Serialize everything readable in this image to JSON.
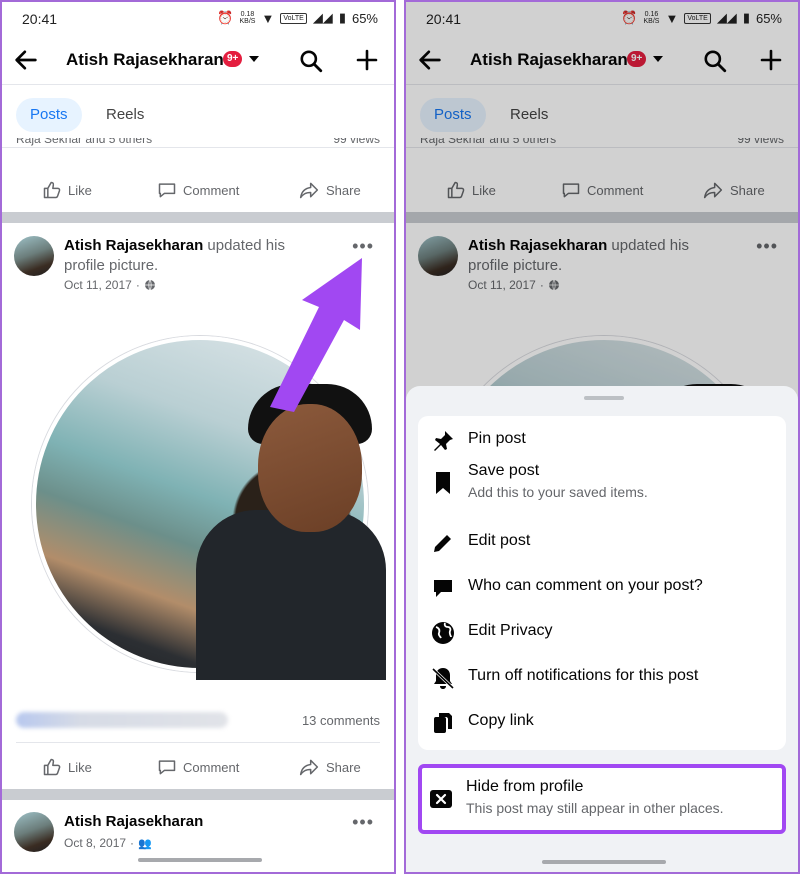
{
  "status_bar": {
    "time": "20:41",
    "left_speed": "0.18",
    "right_speed": "0.16",
    "speed_unit": "KB/S",
    "network": "VoLTE",
    "battery": "65%"
  },
  "header": {
    "title": "Atish Rajasekharan",
    "notification_badge": "9+"
  },
  "tabs": [
    {
      "label": "Posts",
      "active": true
    },
    {
      "label": "Reels",
      "active": false
    }
  ],
  "prev_post": {
    "reactions_text": "Raja Sekhar and 5 others",
    "views_text": "99 views"
  },
  "actions": {
    "like": "Like",
    "comment": "Comment",
    "share": "Share"
  },
  "post": {
    "author": "Atish Rajasekharan",
    "action_text": "updated his profile picture.",
    "date": "Oct 11, 2017",
    "comments_count": "13 comments"
  },
  "next_post": {
    "author": "Atish Rajasekharan",
    "date": "Oct 8, 2017"
  },
  "sheet_menu": {
    "items": [
      {
        "label": "Pin post",
        "icon": "pin-icon"
      },
      {
        "label": "Save post",
        "sublabel": "Add this to your saved items.",
        "icon": "bookmark-icon"
      },
      {
        "label": "Edit post",
        "icon": "pencil-icon"
      },
      {
        "label": "Who can comment on your post?",
        "icon": "comment-bubble-icon"
      },
      {
        "label": "Edit Privacy",
        "icon": "globe-icon"
      },
      {
        "label": "Turn off notifications for this post",
        "icon": "bell-off-icon"
      },
      {
        "label": "Copy link",
        "icon": "copy-icon"
      }
    ],
    "hide": {
      "label": "Hide from profile",
      "sublabel": "This post may still appear in other places.",
      "icon": "close-square-icon"
    }
  },
  "colors": {
    "accent": "#1877f2",
    "highlight": "#a148f2",
    "badge": "#e41e3f"
  }
}
